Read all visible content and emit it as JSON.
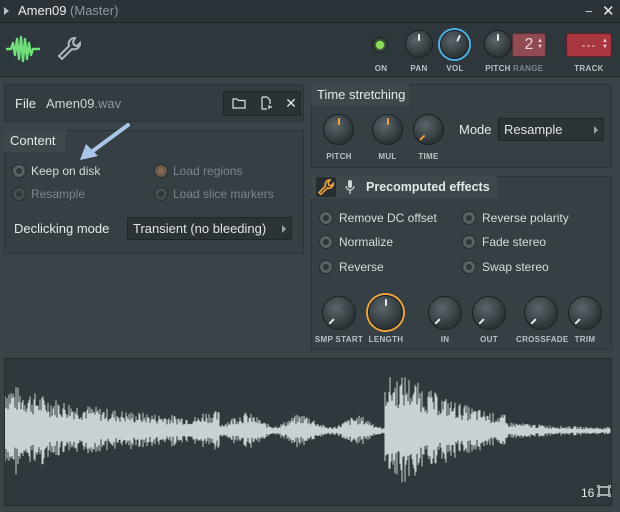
{
  "window": {
    "title": "Amen09",
    "subtitle": "(Master)",
    "minimize_glyph": "−",
    "close_glyph": "✕"
  },
  "toolbar": {
    "sample_icon": "waveform-icon",
    "settings_icon": "wrench-icon",
    "on_label": "ON",
    "pan_label": "PAN",
    "volume_label": "VOL",
    "pitch_label": "PITCH",
    "range_label": "RANGE",
    "range_value": "2",
    "track_label": "TRACK",
    "track_value": "---",
    "accent_color": "#4fb3e8",
    "on_led_color": "#8de05a"
  },
  "file": {
    "label": "File",
    "name": "Amen09",
    "ext": ".wav",
    "open_icon": "folder-icon",
    "browse_icon": "browse-file-icon",
    "clear_icon": "close-icon"
  },
  "content": {
    "tab": "Content",
    "options": {
      "keep_on_disk": "Keep on disk",
      "resample": "Resample",
      "load_regions": "Load regions",
      "load_slice_markers": "Load slice markers"
    },
    "declicking_label": "Declicking mode",
    "declicking_value": "Transient (no bleeding)"
  },
  "time_stretching": {
    "tab": "Time stretching",
    "pitch_label": "PITCH",
    "mul_label": "MUL",
    "time_label": "TIME",
    "mode_label": "Mode",
    "mode_value": "Resample"
  },
  "precomputed": {
    "tab": "Precomputed effects",
    "wrench_icon": "wrench-icon",
    "mic_icon": "microphone-icon",
    "effects": {
      "remove_dc": "Remove DC offset",
      "normalize": "Normalize",
      "reverse": "Reverse",
      "reverse_polarity": "Reverse polarity",
      "fade_stereo": "Fade stereo",
      "swap_stereo": "Swap stereo"
    },
    "knobs": {
      "smp_start": "SMP START",
      "length": "LENGTH",
      "in": "IN",
      "out": "OUT",
      "crossfade": "CROSSFADE",
      "trim": "TRIM"
    },
    "length_color": "#f2a33a"
  },
  "waveform": {
    "zoom_value": "16",
    "zoom_icon": "zoom-fit-icon"
  }
}
